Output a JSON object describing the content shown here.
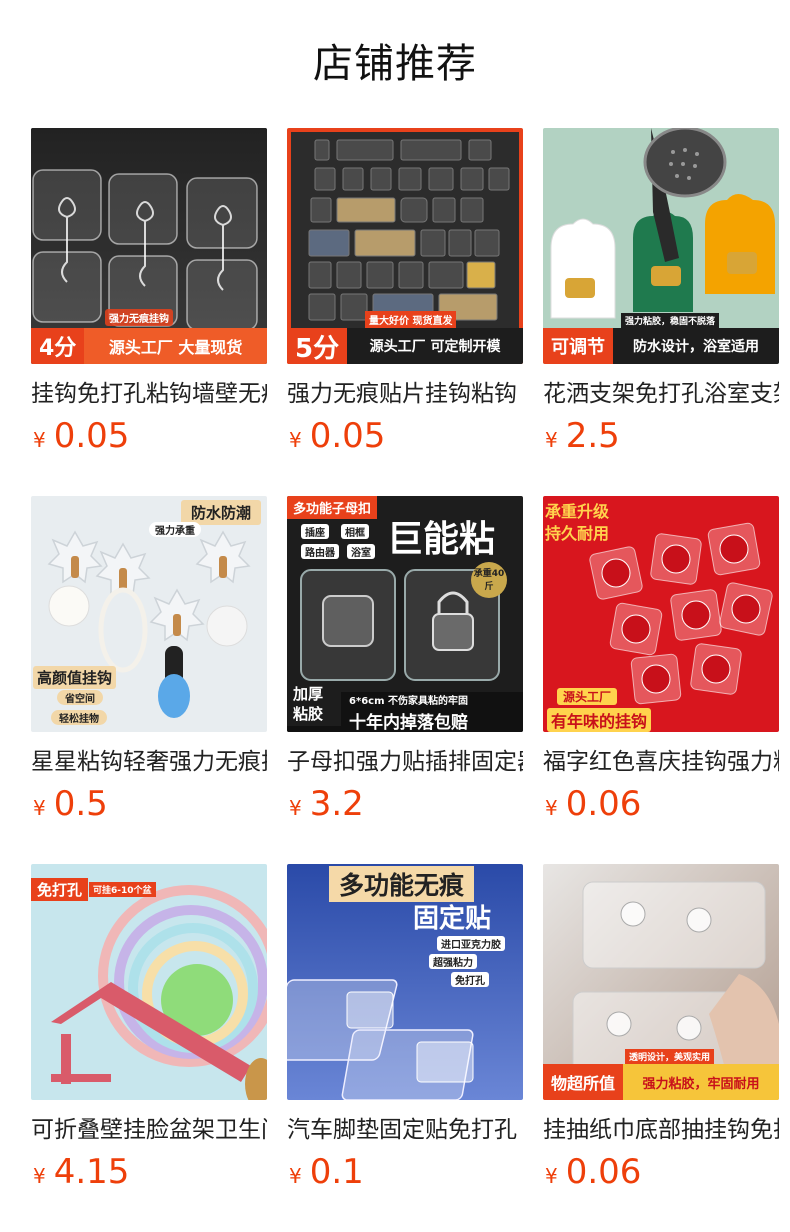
{
  "page": {
    "title": "店铺推荐"
  },
  "currency_symbol": "¥",
  "products": [
    {
      "name": "挂钩免打孔粘钩墙壁无痕挂钩",
      "price": "0.05",
      "badge_main": "4分",
      "badge_top": "强力无痕挂钩",
      "badge_sub": "源头工厂 大量现货",
      "image": "transparent-hooks",
      "colors": {
        "bg": "#1a1a1a",
        "badge": "#e8411b",
        "badge_sub": "#ef5c28"
      }
    },
    {
      "name": "强力无痕贴片挂钩粘钩",
      "price": "0.05",
      "badge_main": "5分",
      "badge_top": "量大好价 现货直发",
      "badge_sub": "源头工厂 可定制开模",
      "image": "adhesive-pads-grid",
      "colors": {
        "bg": "#2a2a2a",
        "badge": "#e8411b",
        "badge_sub": "#1d1d1d"
      }
    },
    {
      "name": "花洒支架免打孔浴室支架",
      "price": "2.5",
      "badge_main": "可调节",
      "badge_top": "强力粘胶，稳固不脱落",
      "badge_sub": "防水设计，浴室适用",
      "image": "shower-holder",
      "colors": {
        "bg": "#b9d8c9",
        "badge": "#e8411b",
        "badge_sub": "#1d1d1d"
      }
    },
    {
      "name": "星星粘钩轻奢强力无痕挂钩",
      "price": "0.5",
      "tag_top": "防水防潮",
      "tag_top_sub": "强力承重",
      "tag_bottom": "高颜值挂钩",
      "tag_bottom_a": "省空间",
      "tag_bottom_b": "轻松挂物",
      "image": "flower-hooks",
      "colors": {
        "bg": "#e9eef1",
        "tag": "#f2d7a8"
      }
    },
    {
      "name": "子母扣强力贴插排固定器",
      "price": "3.2",
      "tag_top": "多功能子母扣",
      "chips": [
        "插座",
        "相框",
        "路由器",
        "浴室"
      ],
      "headline": "巨能粘",
      "seal": "承重40斤",
      "strip": "6*6cm 不伤家具粘的牢固",
      "strip_big": "十年内掉落包赔",
      "side_tag": "加厚粘胶",
      "image": "buckle-pads",
      "colors": {
        "bg": "#1d1d1d",
        "accent": "#e8411b"
      }
    },
    {
      "name": "福字红色喜庆挂钩强力粘钩",
      "price": "0.06",
      "tag_top": "承重升级",
      "tag_top2": "持久耐用",
      "tag_bottom_small": "源头工厂",
      "tag_bottom": "有年味的挂钩",
      "image": "red-fu-hooks",
      "colors": {
        "bg": "#d8161e",
        "tag": "#ffd34d"
      }
    },
    {
      "name": "可折叠壁挂脸盆架卫生间",
      "price": "4.15",
      "tag_top": "免打孔",
      "tag_top_sub": "可挂6-10个盆",
      "image": "basin-rack",
      "colors": {
        "bg": "#c9e7ee",
        "tag": "#e8411b"
      }
    },
    {
      "name": "汽车脚垫固定贴免打孔",
      "price": "0.1",
      "headline": "多功能无痕",
      "headline2": "固定贴",
      "chips": [
        "进口亚克力胶",
        "超强粘力",
        "免打孔"
      ],
      "image": "car-mat-clips",
      "colors": {
        "bg": "#3558b8",
        "headline": "#f5d9a8"
      }
    },
    {
      "name": "挂抽纸巾底部抽挂钩免打孔",
      "price": "0.06",
      "badge_main": "物超所值",
      "badge_top": "透明设计，美观实用",
      "badge_sub": "强力粘胶，牢固耐用",
      "image": "clear-tissue-hooks",
      "colors": {
        "bg": "#8a7566",
        "badge": "#e8411b",
        "badge_sub": "#f6c53a"
      }
    }
  ]
}
